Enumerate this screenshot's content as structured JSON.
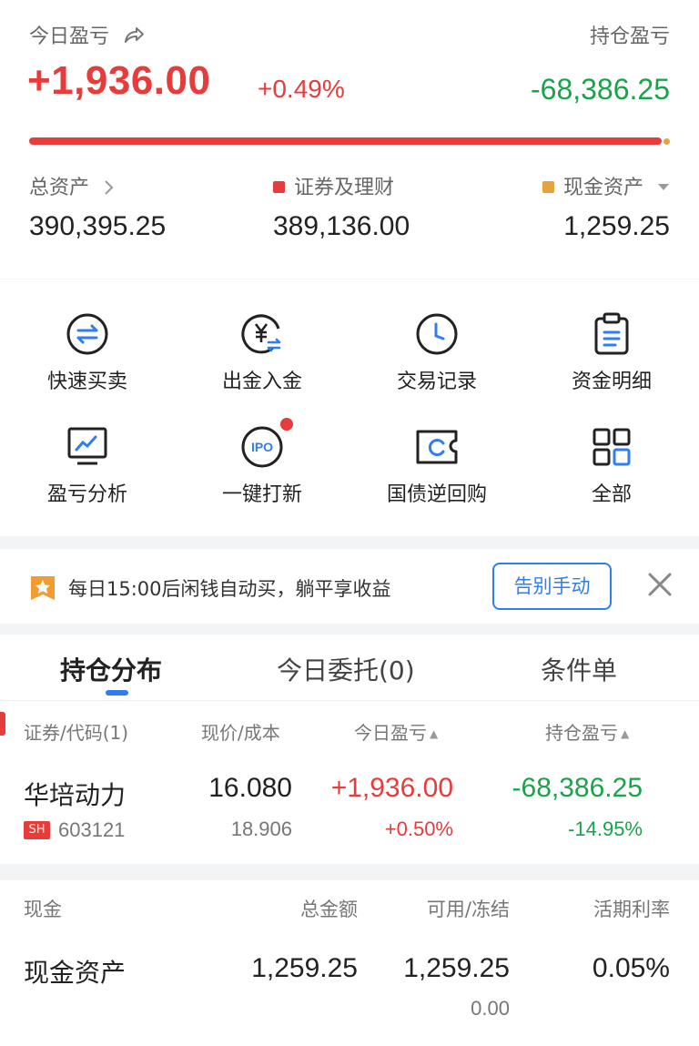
{
  "summary": {
    "today_pl_label": "今日盈亏",
    "today_pl_value": "+1,936.00",
    "today_pl_pct": "+0.49%",
    "position_pl_label": "持仓盈亏",
    "position_pl_value": "-68,386.25",
    "total_assets_label": "总资产",
    "total_assets_value": "390,395.25",
    "securities_label": "证券及理财",
    "securities_value": "389,136.00",
    "cash_label": "现金资产",
    "cash_value": "1,259.25",
    "progress_securities_fraction": 0.9968
  },
  "menu": [
    {
      "label": "快速买卖",
      "icon": "swap-icon"
    },
    {
      "label": "出金入金",
      "icon": "yuan-transfer-icon"
    },
    {
      "label": "交易记录",
      "icon": "clock-icon"
    },
    {
      "label": "资金明细",
      "icon": "clipboard-icon"
    },
    {
      "label": "盈亏分析",
      "icon": "chart-monitor-icon"
    },
    {
      "label": "一键打新",
      "icon": "ipo-icon"
    },
    {
      "label": "国债逆回购",
      "icon": "ticket-icon"
    },
    {
      "label": "全部",
      "icon": "grid-icon"
    }
  ],
  "promo": {
    "text": "每日15:00后闲钱自动买，躺平享收益",
    "button": "告别手动"
  },
  "tabs": [
    "持仓分布",
    "今日委托(0)",
    "条件单"
  ],
  "holdings": {
    "headers": [
      "证券/代码(1)",
      "现价/成本",
      "今日盈亏",
      "持仓盈亏"
    ],
    "rows": [
      {
        "name": "华培动力",
        "market": "SH",
        "code": "603121",
        "price": "16.080",
        "cost": "18.906",
        "today_pl": "+1,936.00",
        "today_pct": "+0.50%",
        "position_pl": "-68,386.25",
        "position_pct": "-14.95%"
      }
    ]
  },
  "cash": {
    "headers": [
      "现金",
      "总金额",
      "可用/冻结",
      "活期利率"
    ],
    "row": {
      "name": "现金资产",
      "total": "1,259.25",
      "available": "1,259.25",
      "frozen": "0.00",
      "rate": "0.05%"
    }
  },
  "colors": {
    "up": "#e63c3c",
    "down": "#1aa34a",
    "accent": "#2f7ef0",
    "cash": "#e6a23c"
  }
}
